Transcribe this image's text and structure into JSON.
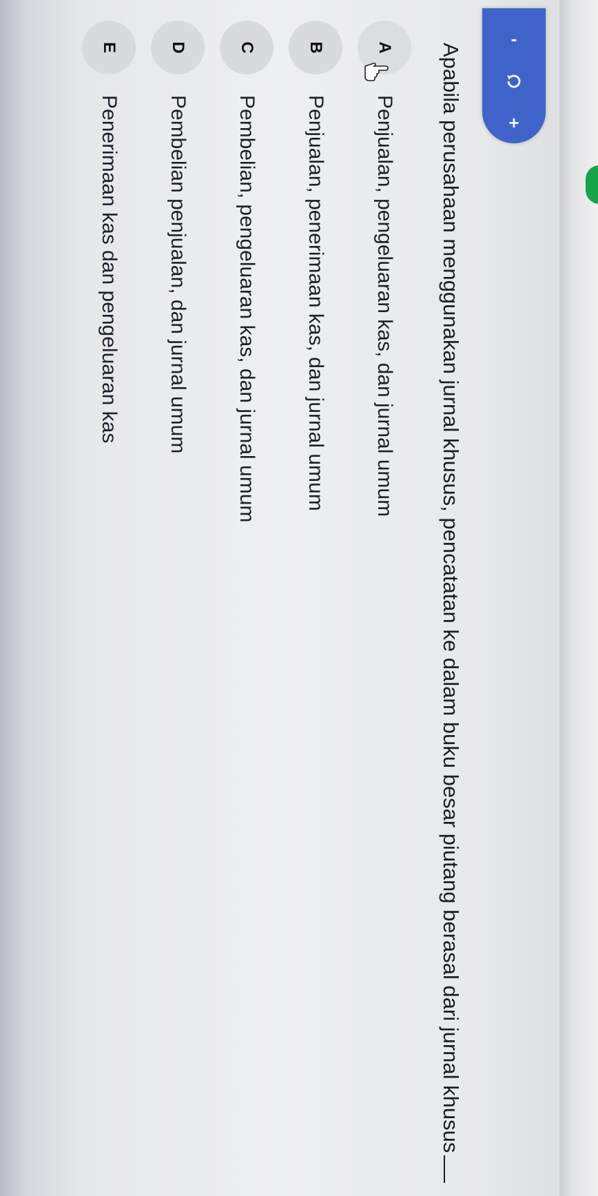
{
  "toolbar": {
    "minus_icon": "minus-icon",
    "refresh_icon": "refresh-icon",
    "plus_icon": "plus-icon",
    "minus_glyph": "-",
    "plus_glyph": "+"
  },
  "question": {
    "text": "Apabila perusahaan menggunakan jurnal khusus, pencatatan ke dalam buku besar piutang berasal dari jurnal khusus"
  },
  "options": [
    {
      "letter": "A",
      "text": "Penjualan, pengeluaran kas, dan jurnal umum"
    },
    {
      "letter": "B",
      "text": "Penjualan, penerimaan kas, dan jurnal umum"
    },
    {
      "letter": "C",
      "text": "Pembelian, pengeluaran kas, dan jurnal umum"
    },
    {
      "letter": "D",
      "text": "Pembelian penjualan, dan jurnal umum"
    },
    {
      "letter": "E",
      "text": "Penerimaan kas dan pengeluaran kas"
    }
  ],
  "colors": {
    "accent": "#3f63c8",
    "green_tab": "#17a34a"
  }
}
